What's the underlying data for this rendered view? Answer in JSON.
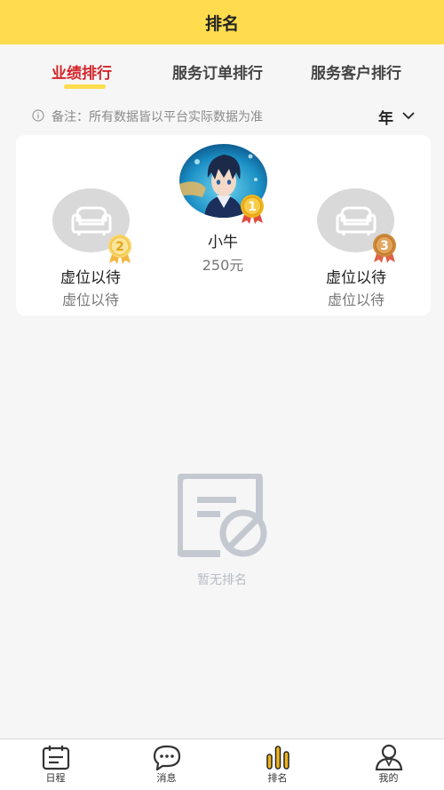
{
  "header": {
    "title": "排名"
  },
  "tabs": [
    {
      "label": "业绩排行",
      "active": true
    },
    {
      "label": "服务订单排行",
      "active": false
    },
    {
      "label": "服务客户排行",
      "active": false
    }
  ],
  "note": {
    "icon": "info-icon",
    "text": "备注：所有数据皆以平台实际数据为准"
  },
  "period": {
    "selected": "年",
    "icon": "chevron-down-icon"
  },
  "podium": {
    "first": {
      "rank": "1",
      "name": "小牛",
      "value": "250元"
    },
    "second": {
      "rank": "2",
      "name": "虚位以待",
      "value": "虚位以待"
    },
    "third": {
      "rank": "3",
      "name": "虚位以待",
      "value": "虚位以待"
    }
  },
  "empty_state": {
    "icon": "no-document-icon",
    "text": "暂无排名"
  },
  "bottom_nav": [
    {
      "label": "日程",
      "icon": "calendar-icon",
      "active": false
    },
    {
      "label": "消息",
      "icon": "chat-bubble-icon",
      "active": false
    },
    {
      "label": "排名",
      "icon": "ranking-bars-icon",
      "active": true
    },
    {
      "label": "我的",
      "icon": "user-profile-icon",
      "active": false
    }
  ],
  "colors": {
    "brand_yellow": "#ffdc4e",
    "active_red": "#d3262b",
    "gold": "#f0b51d",
    "silver": "#f3c64a",
    "bronze": "#cf8a3c"
  }
}
